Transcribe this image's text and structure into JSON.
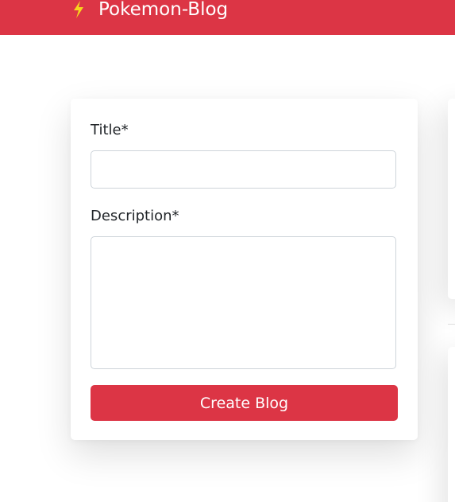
{
  "header": {
    "brand_icon": "lightning-bolt-icon",
    "brand_title": "Pokemon-Blog"
  },
  "form": {
    "title_label": "Title*",
    "title_value": "",
    "description_label": "Description*",
    "description_value": "",
    "submit_label": "Create Blog"
  },
  "colors": {
    "brand_red": "#dc3545",
    "bolt_yellow": "#f7d51d"
  }
}
